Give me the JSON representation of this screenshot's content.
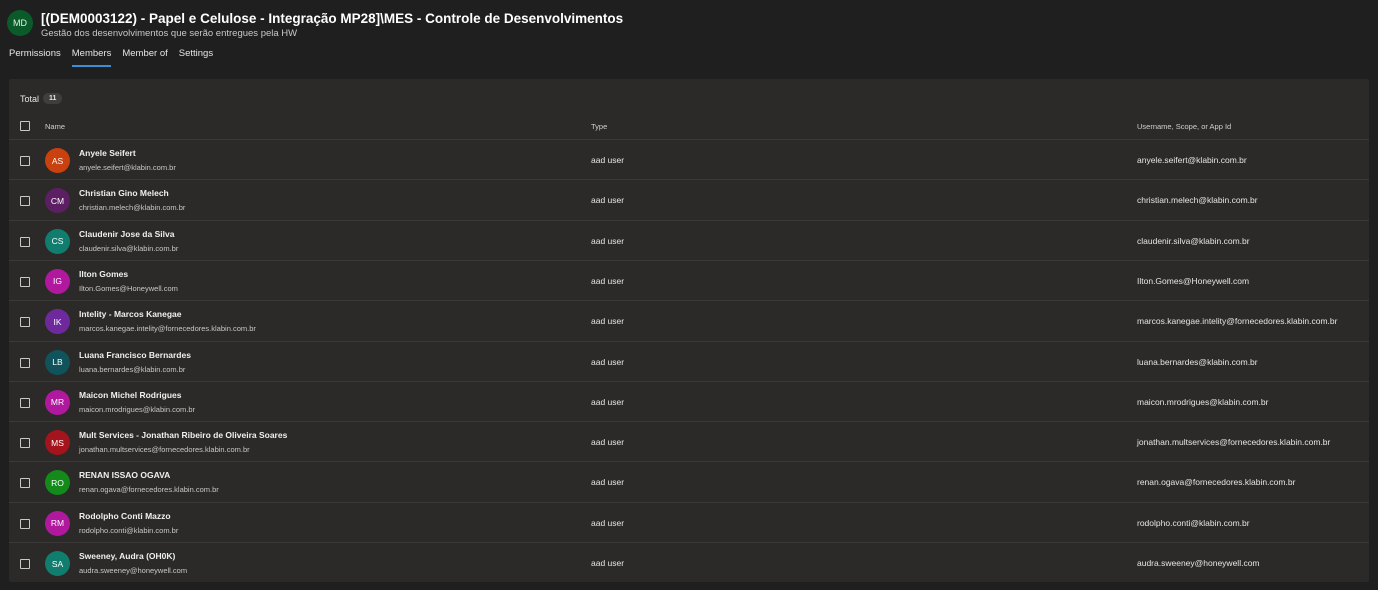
{
  "header": {
    "avatar_initials": "MD",
    "title": "[(DEM0003122) - Papel e Celulose - Integração MP28]\\MES - Controle de Desenvolvimentos",
    "subtitle": "Gestão dos desenvolvimentos que serão entregues pela HW"
  },
  "tabs": [
    {
      "label": "Permissions",
      "active": false
    },
    {
      "label": "Members",
      "active": true
    },
    {
      "label": "Member of",
      "active": false
    },
    {
      "label": "Settings",
      "active": false
    }
  ],
  "table": {
    "total_label": "Total",
    "total_count": "11",
    "columns": {
      "name": "Name",
      "type": "Type",
      "username": "Username, Scope, or App Id"
    },
    "rows": [
      {
        "initials": "AS",
        "color": "#c8410f",
        "name": "Anyele Seifert",
        "email": "anyele.seifert@klabin.com.br",
        "type": "aad user",
        "username": "anyele.seifert@klabin.com.br"
      },
      {
        "initials": "CM",
        "color": "#5c1f63",
        "name": "Christian Gino Melech",
        "email": "christian.melech@klabin.com.br",
        "type": "aad user",
        "username": "christian.melech@klabin.com.br"
      },
      {
        "initials": "CS",
        "color": "#117d6e",
        "name": "Claudenir Jose da Silva",
        "email": "claudenir.silva@klabin.com.br",
        "type": "aad user",
        "username": "claudenir.silva@klabin.com.br"
      },
      {
        "initials": "IG",
        "color": "#b0189e",
        "name": "Ilton Gomes",
        "email": "Ilton.Gomes@Honeywell.com",
        "type": "aad user",
        "username": "Ilton.Gomes@Honeywell.com"
      },
      {
        "initials": "IK",
        "color": "#6e2a9c",
        "name": "Intelity - Marcos Kanegae",
        "email": "marcos.kanegae.intelity@fornecedores.klabin.com.br",
        "type": "aad user",
        "username": "marcos.kanegae.intelity@fornecedores.klabin.com.br"
      },
      {
        "initials": "LB",
        "color": "#10535a",
        "name": "Luana Francisco Bernardes",
        "email": "luana.bernardes@klabin.com.br",
        "type": "aad user",
        "username": "luana.bernardes@klabin.com.br"
      },
      {
        "initials": "MR",
        "color": "#b0189e",
        "name": "Maicon Michel Rodrigues",
        "email": "maicon.mrodrigues@klabin.com.br",
        "type": "aad user",
        "username": "maicon.mrodrigues@klabin.com.br"
      },
      {
        "initials": "MS",
        "color": "#a4141d",
        "name": "Mult Services - Jonathan Ribeiro de Oliveira Soares",
        "email": "jonathan.multservices@fornecedores.klabin.com.br",
        "type": "aad user",
        "username": "jonathan.multservices@fornecedores.klabin.com.br"
      },
      {
        "initials": "RO",
        "color": "#138a19",
        "name": "RENAN ISSAO OGAVA",
        "email": "renan.ogava@fornecedores.klabin.com.br",
        "type": "aad user",
        "username": "renan.ogava@fornecedores.klabin.com.br"
      },
      {
        "initials": "RM",
        "color": "#b0189e",
        "name": "Rodolpho Conti Mazzo",
        "email": "rodolpho.conti@klabin.com.br",
        "type": "aad user",
        "username": "rodolpho.conti@klabin.com.br"
      },
      {
        "initials": "SA",
        "color": "#117d6e",
        "name": "Sweeney, Audra (OH0K)",
        "email": "audra.sweeney@honeywell.com",
        "type": "aad user",
        "username": "audra.sweeney@honeywell.com"
      }
    ]
  }
}
